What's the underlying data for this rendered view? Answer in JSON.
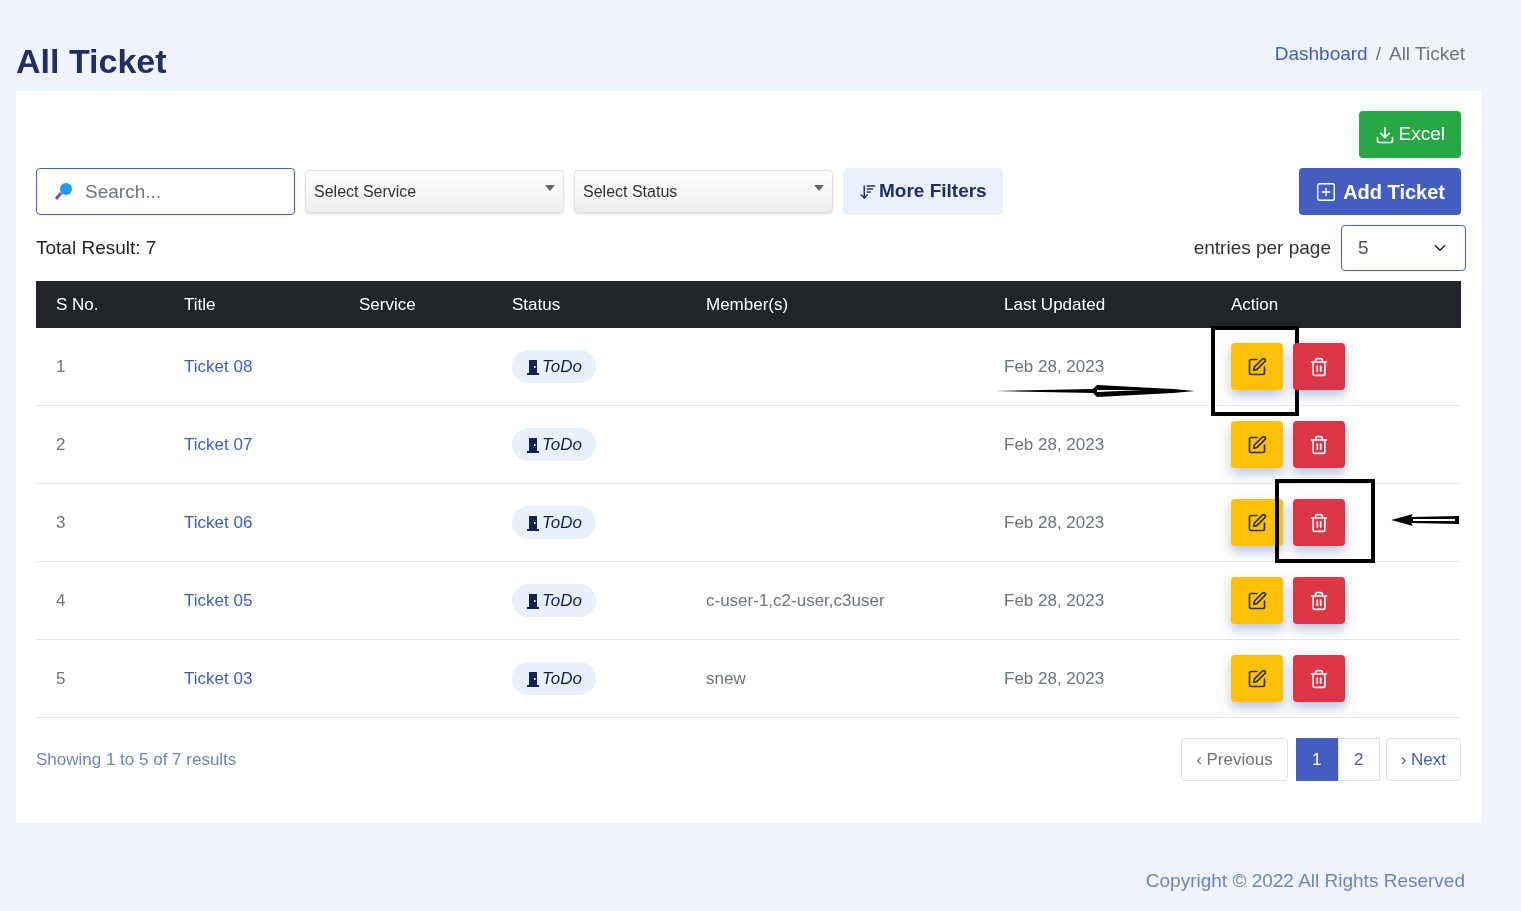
{
  "page_title": "All Ticket",
  "breadcrumb": [
    {
      "label": "Dashboard",
      "link": true
    },
    {
      "label": "All Ticket",
      "link": false
    }
  ],
  "breadcrumb_separator": "/",
  "excel_button": "Excel",
  "search": {
    "placeholder": "Search..."
  },
  "service_select": "Select Service",
  "status_select": "Select Status",
  "more_filters": "More Filters",
  "add_button": "Add Ticket",
  "total_result": "Total Result: 7",
  "entries_label": "entries per page",
  "entries_value": "5",
  "table": {
    "columns": [
      "S No.",
      "Title",
      "Service",
      "Status",
      "Member(s)",
      "Last Updated",
      "Action"
    ],
    "rows": [
      {
        "sno": "1",
        "title": "Ticket 08",
        "status": "ToDo",
        "members": "",
        "updated": "Feb 28, 2023",
        "edit_highlighted": true,
        "delete_highlighted": false
      },
      {
        "sno": "2",
        "title": "Ticket 07",
        "status": "ToDo",
        "members": "",
        "updated": "Feb 28, 2023",
        "edit_highlighted": false,
        "delete_highlighted": false
      },
      {
        "sno": "3",
        "title": "Ticket 06",
        "status": "ToDo",
        "members": "",
        "updated": "Feb 28, 2023",
        "edit_highlighted": false,
        "delete_highlighted": true
      },
      {
        "sno": "4",
        "title": "Ticket 05",
        "status": "ToDo",
        "members": "c-user-1,c2-user,c3user",
        "updated": "Feb 28, 2023",
        "edit_highlighted": false,
        "delete_highlighted": false
      },
      {
        "sno": "5",
        "title": "Ticket 03",
        "status": "ToDo",
        "members": "snew",
        "updated": "Feb 28, 2023",
        "edit_highlighted": false,
        "delete_highlighted": false
      }
    ]
  },
  "showing": "Showing 1 to 5 of 7 results",
  "pagination": {
    "previous": "‹ Previous",
    "pages": [
      {
        "label": "1",
        "selected": true
      },
      {
        "label": "2",
        "selected": false
      }
    ],
    "next": "› Next"
  },
  "footer": "Copyright © 2022 All Rights Reserved"
}
